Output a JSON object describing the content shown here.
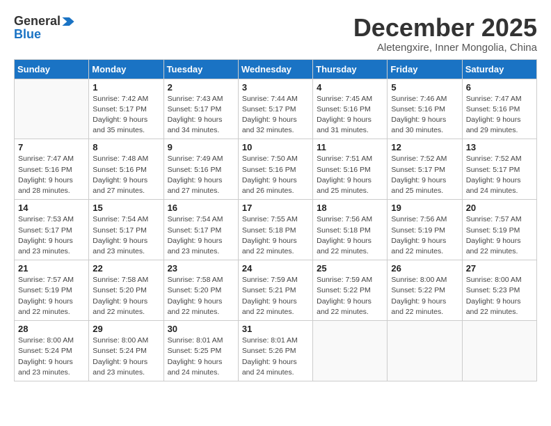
{
  "logo": {
    "general": "General",
    "blue": "Blue"
  },
  "header": {
    "month": "December 2025",
    "location": "Aletengxire, Inner Mongolia, China"
  },
  "days_of_week": [
    "Sunday",
    "Monday",
    "Tuesday",
    "Wednesday",
    "Thursday",
    "Friday",
    "Saturday"
  ],
  "weeks": [
    [
      {
        "day": "",
        "info": ""
      },
      {
        "day": "1",
        "info": "Sunrise: 7:42 AM\nSunset: 5:17 PM\nDaylight: 9 hours\nand 35 minutes."
      },
      {
        "day": "2",
        "info": "Sunrise: 7:43 AM\nSunset: 5:17 PM\nDaylight: 9 hours\nand 34 minutes."
      },
      {
        "day": "3",
        "info": "Sunrise: 7:44 AM\nSunset: 5:17 PM\nDaylight: 9 hours\nand 32 minutes."
      },
      {
        "day": "4",
        "info": "Sunrise: 7:45 AM\nSunset: 5:16 PM\nDaylight: 9 hours\nand 31 minutes."
      },
      {
        "day": "5",
        "info": "Sunrise: 7:46 AM\nSunset: 5:16 PM\nDaylight: 9 hours\nand 30 minutes."
      },
      {
        "day": "6",
        "info": "Sunrise: 7:47 AM\nSunset: 5:16 PM\nDaylight: 9 hours\nand 29 minutes."
      }
    ],
    [
      {
        "day": "7",
        "info": "Sunrise: 7:47 AM\nSunset: 5:16 PM\nDaylight: 9 hours\nand 28 minutes."
      },
      {
        "day": "8",
        "info": "Sunrise: 7:48 AM\nSunset: 5:16 PM\nDaylight: 9 hours\nand 27 minutes."
      },
      {
        "day": "9",
        "info": "Sunrise: 7:49 AM\nSunset: 5:16 PM\nDaylight: 9 hours\nand 27 minutes."
      },
      {
        "day": "10",
        "info": "Sunrise: 7:50 AM\nSunset: 5:16 PM\nDaylight: 9 hours\nand 26 minutes."
      },
      {
        "day": "11",
        "info": "Sunrise: 7:51 AM\nSunset: 5:16 PM\nDaylight: 9 hours\nand 25 minutes."
      },
      {
        "day": "12",
        "info": "Sunrise: 7:52 AM\nSunset: 5:17 PM\nDaylight: 9 hours\nand 25 minutes."
      },
      {
        "day": "13",
        "info": "Sunrise: 7:52 AM\nSunset: 5:17 PM\nDaylight: 9 hours\nand 24 minutes."
      }
    ],
    [
      {
        "day": "14",
        "info": "Sunrise: 7:53 AM\nSunset: 5:17 PM\nDaylight: 9 hours\nand 23 minutes."
      },
      {
        "day": "15",
        "info": "Sunrise: 7:54 AM\nSunset: 5:17 PM\nDaylight: 9 hours\nand 23 minutes."
      },
      {
        "day": "16",
        "info": "Sunrise: 7:54 AM\nSunset: 5:17 PM\nDaylight: 9 hours\nand 23 minutes."
      },
      {
        "day": "17",
        "info": "Sunrise: 7:55 AM\nSunset: 5:18 PM\nDaylight: 9 hours\nand 22 minutes."
      },
      {
        "day": "18",
        "info": "Sunrise: 7:56 AM\nSunset: 5:18 PM\nDaylight: 9 hours\nand 22 minutes."
      },
      {
        "day": "19",
        "info": "Sunrise: 7:56 AM\nSunset: 5:19 PM\nDaylight: 9 hours\nand 22 minutes."
      },
      {
        "day": "20",
        "info": "Sunrise: 7:57 AM\nSunset: 5:19 PM\nDaylight: 9 hours\nand 22 minutes."
      }
    ],
    [
      {
        "day": "21",
        "info": "Sunrise: 7:57 AM\nSunset: 5:19 PM\nDaylight: 9 hours\nand 22 minutes."
      },
      {
        "day": "22",
        "info": "Sunrise: 7:58 AM\nSunset: 5:20 PM\nDaylight: 9 hours\nand 22 minutes."
      },
      {
        "day": "23",
        "info": "Sunrise: 7:58 AM\nSunset: 5:20 PM\nDaylight: 9 hours\nand 22 minutes."
      },
      {
        "day": "24",
        "info": "Sunrise: 7:59 AM\nSunset: 5:21 PM\nDaylight: 9 hours\nand 22 minutes."
      },
      {
        "day": "25",
        "info": "Sunrise: 7:59 AM\nSunset: 5:22 PM\nDaylight: 9 hours\nand 22 minutes."
      },
      {
        "day": "26",
        "info": "Sunrise: 8:00 AM\nSunset: 5:22 PM\nDaylight: 9 hours\nand 22 minutes."
      },
      {
        "day": "27",
        "info": "Sunrise: 8:00 AM\nSunset: 5:23 PM\nDaylight: 9 hours\nand 22 minutes."
      }
    ],
    [
      {
        "day": "28",
        "info": "Sunrise: 8:00 AM\nSunset: 5:24 PM\nDaylight: 9 hours\nand 23 minutes."
      },
      {
        "day": "29",
        "info": "Sunrise: 8:00 AM\nSunset: 5:24 PM\nDaylight: 9 hours\nand 23 minutes."
      },
      {
        "day": "30",
        "info": "Sunrise: 8:01 AM\nSunset: 5:25 PM\nDaylight: 9 hours\nand 24 minutes."
      },
      {
        "day": "31",
        "info": "Sunrise: 8:01 AM\nSunset: 5:26 PM\nDaylight: 9 hours\nand 24 minutes."
      },
      {
        "day": "",
        "info": ""
      },
      {
        "day": "",
        "info": ""
      },
      {
        "day": "",
        "info": ""
      }
    ]
  ]
}
